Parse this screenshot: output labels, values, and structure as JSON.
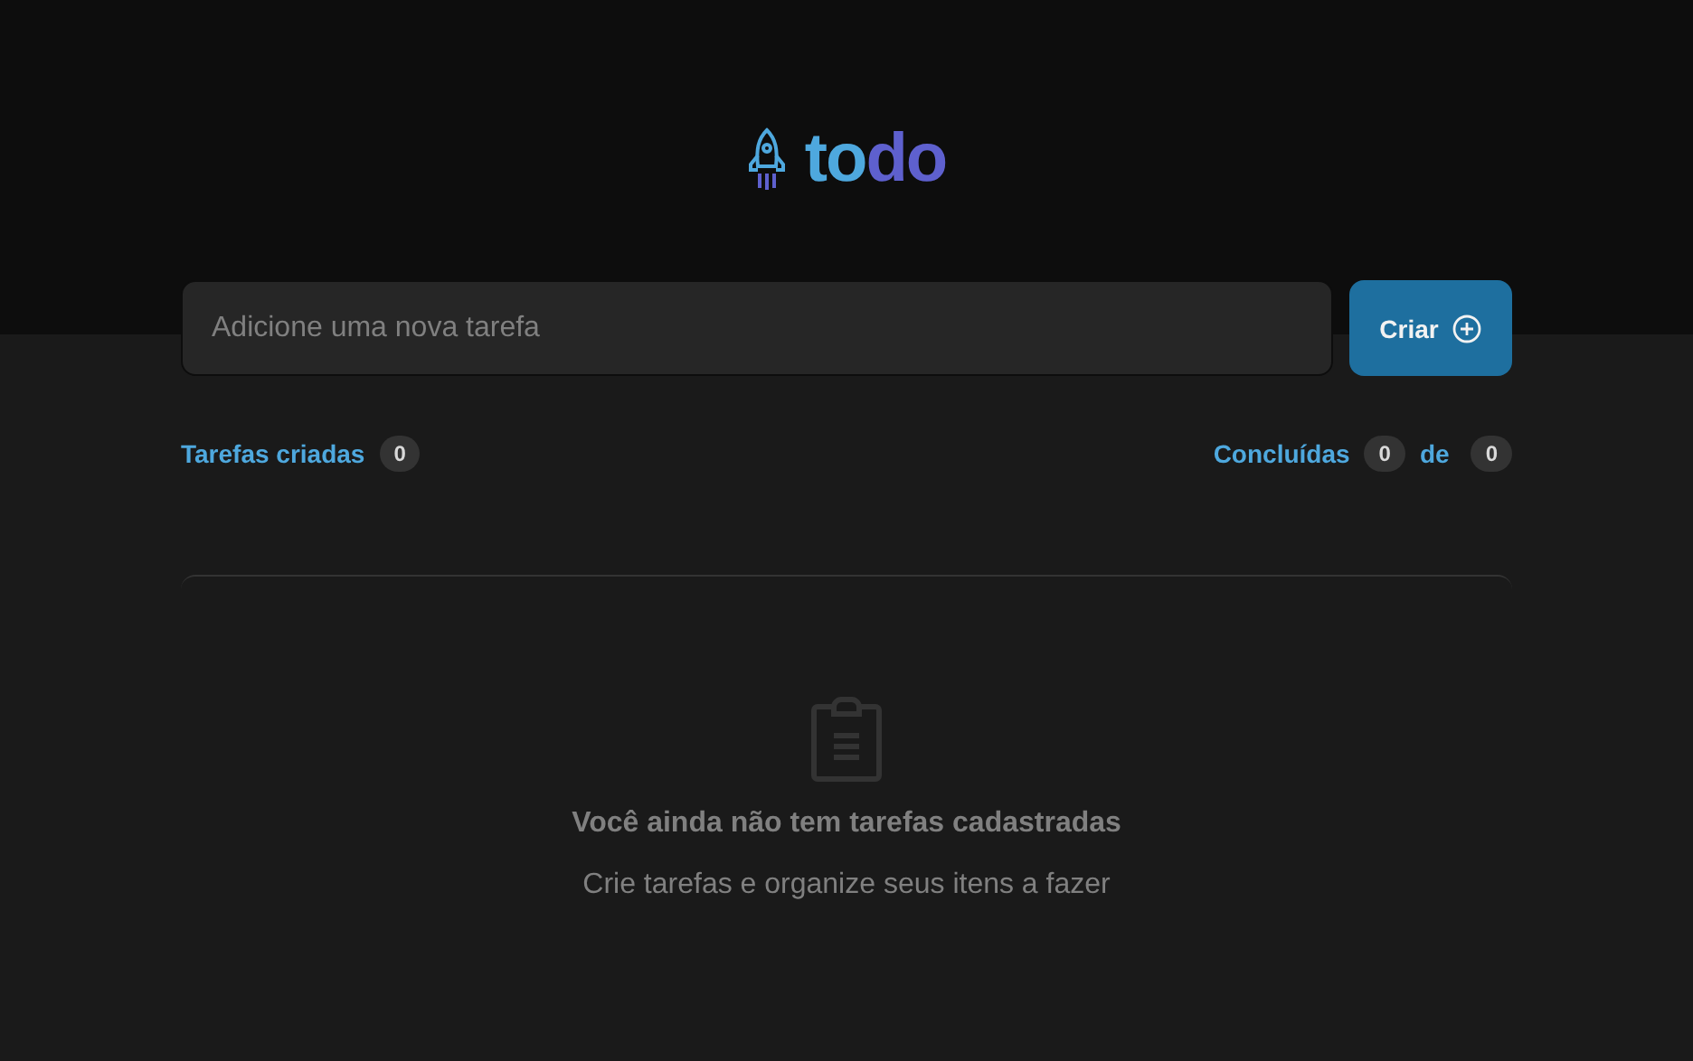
{
  "logo": {
    "parts": [
      "to",
      "do"
    ]
  },
  "new_task": {
    "placeholder": "Adicione uma nova tarefa",
    "button": "Criar"
  },
  "counters": {
    "created": {
      "label": "Tarefas criadas",
      "count": "0"
    },
    "done": {
      "label": "Concluídas",
      "count": "0",
      "separator": "de",
      "total": "0"
    }
  },
  "empty_state": {
    "title": "Você ainda não tem tarefas cadastradas",
    "subtitle": "Crie tarefas e organize seus itens a fazer"
  }
}
